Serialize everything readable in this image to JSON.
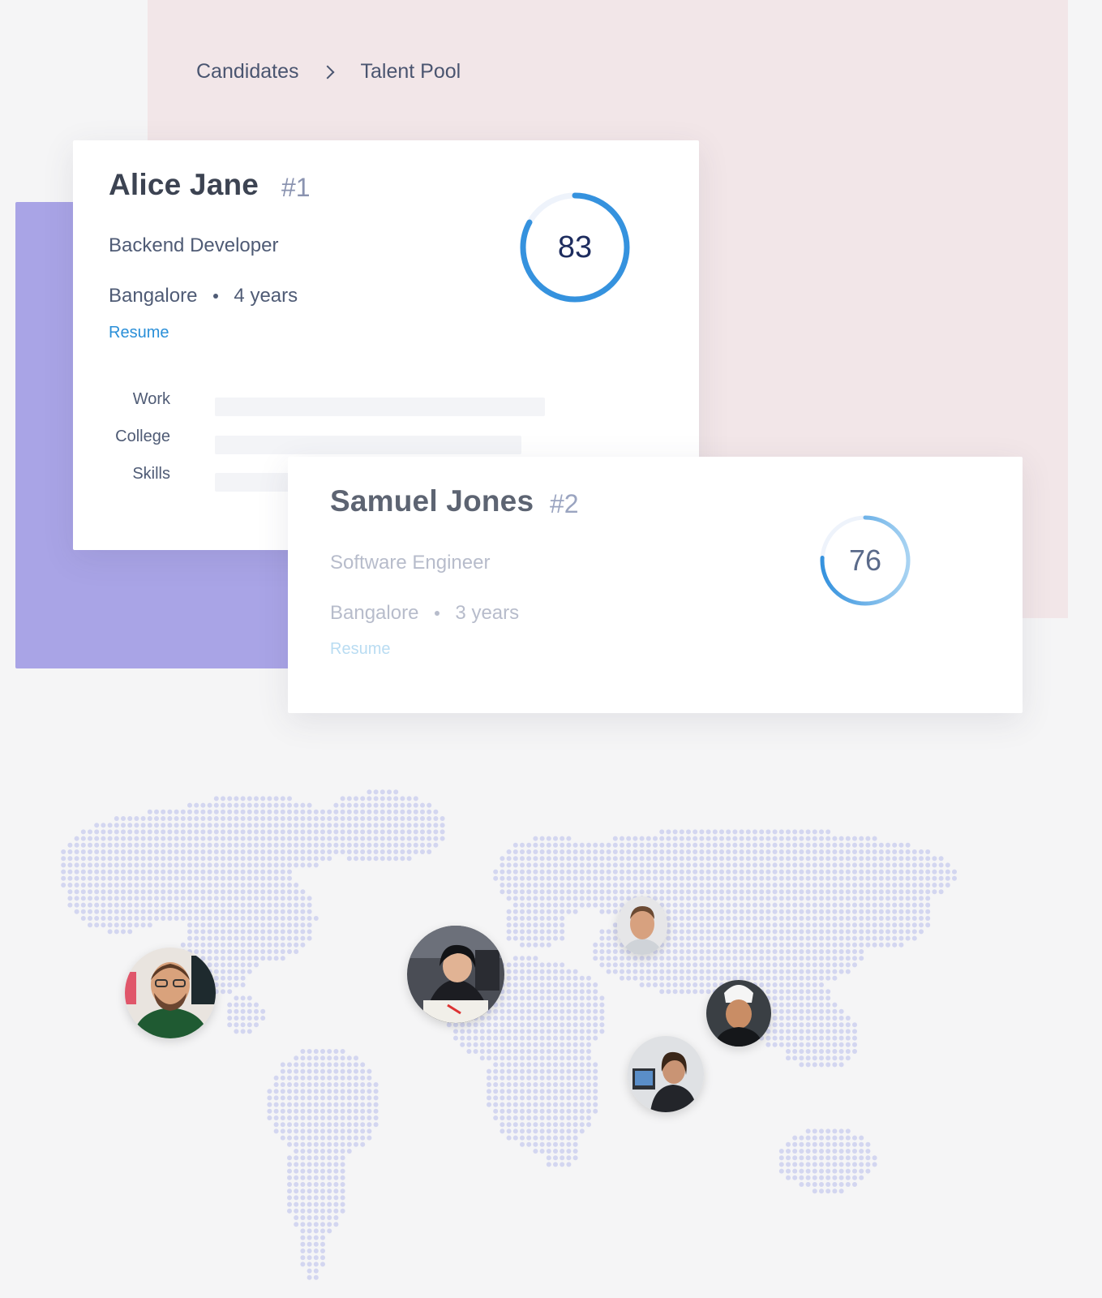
{
  "breadcrumb": {
    "items": [
      "Candidates",
      "Talent Pool"
    ]
  },
  "candidates": [
    {
      "name": "Alice Jane",
      "rank": "#1",
      "role": "Backend Developer",
      "location": "Bangalore",
      "experience": "4 years",
      "resume_label": "Resume",
      "score": "83",
      "score_fraction": 0.83,
      "details": [
        {
          "label": "Work",
          "fill": 0.97
        },
        {
          "label": "College",
          "fill": 0.9
        },
        {
          "label": "Skills",
          "fill": 0.4
        }
      ]
    },
    {
      "name": "Samuel Jones",
      "rank": "#2",
      "role": "Software Engineer",
      "location": "Bangalore",
      "experience": "3 years",
      "resume_label": "Resume",
      "score": "76",
      "score_fraction": 0.76
    }
  ],
  "colors": {
    "accent": "#2a8fd8",
    "ring_primary": "#3592de",
    "ring_secondary": "#8ec5ec",
    "map_dots": "#d3d6f0",
    "purple_panel": "#a9a4e6",
    "pink_panel": "#f2e6e8"
  },
  "map": {
    "avatars": [
      "avatar-photo-1",
      "avatar-photo-2",
      "avatar-photo-3",
      "avatar-photo-4",
      "avatar-photo-5"
    ]
  }
}
